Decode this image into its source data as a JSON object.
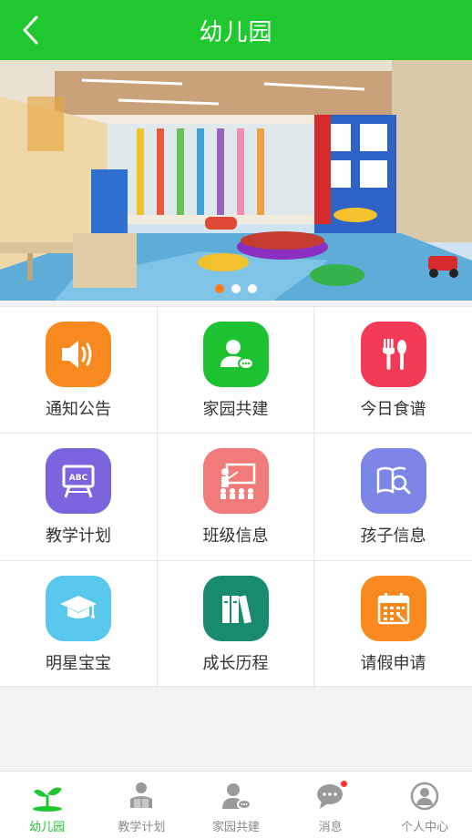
{
  "header": {
    "title": "幼儿园"
  },
  "banner": {
    "dots": 3,
    "active_index": 0
  },
  "menu": [
    {
      "label": "通知公告",
      "icon": "speaker-icon",
      "color": "#f7891f"
    },
    {
      "label": "家园共建",
      "icon": "user-chat-icon",
      "color": "#1dc231"
    },
    {
      "label": "今日食谱",
      "icon": "fork-spoon-icon",
      "color": "#f53a55"
    },
    {
      "label": "教学计划",
      "icon": "blackboard-icon",
      "color": "#7b64dd"
    },
    {
      "label": "班级信息",
      "icon": "teacher-class-icon",
      "color": "#f17b7a"
    },
    {
      "label": "孩子信息",
      "icon": "book-search-icon",
      "color": "#7b86e6"
    },
    {
      "label": "明星宝宝",
      "icon": "graduation-cap-icon",
      "color": "#5ac7ec"
    },
    {
      "label": "成长历程",
      "icon": "books-icon",
      "color": "#188a6e"
    },
    {
      "label": "请假申请",
      "icon": "calendar-icon",
      "color": "#f7891f"
    }
  ],
  "tabs": [
    {
      "label": "幼儿园",
      "icon": "sprout-icon",
      "active": true
    },
    {
      "label": "教学计划",
      "icon": "reader-icon",
      "active": false
    },
    {
      "label": "家园共建",
      "icon": "user-chat-icon",
      "active": false
    },
    {
      "label": "消息",
      "icon": "message-icon",
      "active": false,
      "badge": true
    },
    {
      "label": "个人中心",
      "icon": "profile-icon",
      "active": false
    }
  ],
  "colors": {
    "brand": "#1fc82f",
    "tab_inactive": "#8a8a8a"
  }
}
